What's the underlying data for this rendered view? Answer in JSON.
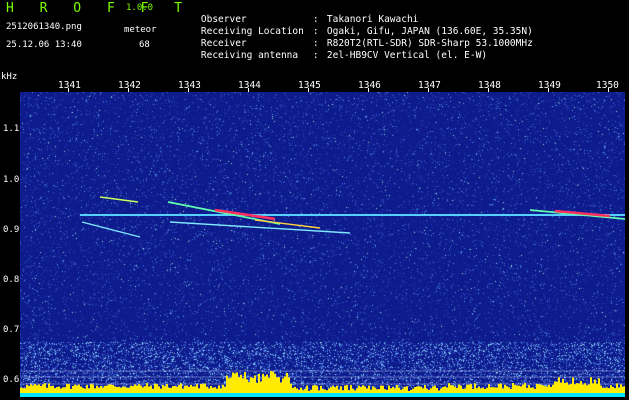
{
  "header": {
    "brand": "H R O F F T",
    "version": "1.0.0",
    "filename": "2512061340.png",
    "datetime": "25.12.06 13:40",
    "meteor_label": "meteor",
    "meteor_count": "68"
  },
  "info": [
    {
      "label": "Observer",
      "sep": ":",
      "value": "Takanori Kawachi"
    },
    {
      "label": "Receiving Location",
      "sep": ":",
      "value": "Ogaki, Gifu, JAPAN (136.60E, 35.35N)"
    },
    {
      "label": "Receiver",
      "sep": ":",
      "value": "R820T2(RTL-SDR) SDR-Sharp 53.1000MHz"
    },
    {
      "label": "Receiving antenna",
      "sep": ":",
      "value": "2el-HB9CV Vertical (el. E-W)"
    }
  ],
  "axis": {
    "unit": "kHz",
    "y_ticks": [
      "1.1",
      "1.0",
      "0.9",
      "0.8",
      "0.7",
      "0.6"
    ],
    "x_ticks": [
      "1341",
      "1342",
      "1343",
      "1344",
      "1345",
      "1346",
      "1347",
      "1348",
      "1349",
      "1350"
    ]
  },
  "colors": {
    "brand": "#7dff00",
    "background": "#0d1b8c",
    "carrier": "#56d0ff",
    "meteor_hot": "#ff3060",
    "noise_bar": "#ffea00",
    "noise_base": "#00e5ff"
  }
}
